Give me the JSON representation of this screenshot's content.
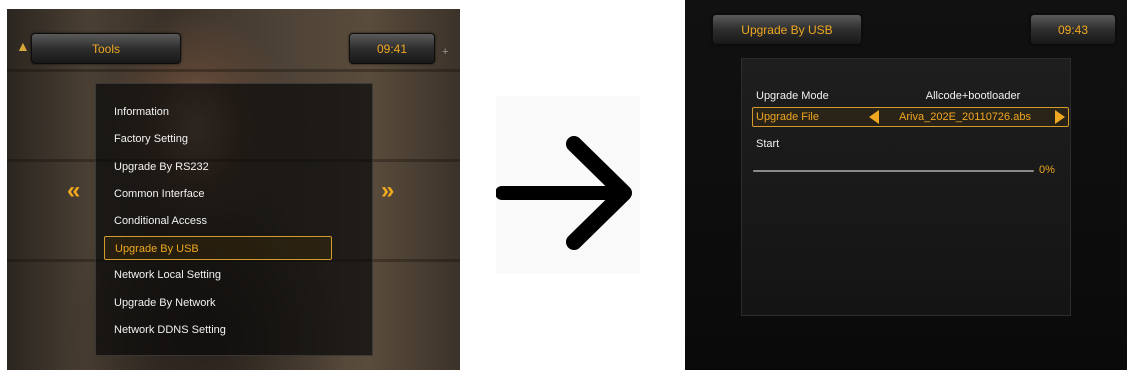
{
  "left_screen": {
    "title": "Tools",
    "clock": "09:41",
    "prev_glyph": "«",
    "next_glyph": "»",
    "logo_icon": "ariva-logo-icon",
    "menu_items": [
      "Information",
      "Factory Setting",
      "Upgrade By RS232",
      "Common Interface",
      "Conditional Access",
      "Upgrade By USB",
      "Network Local Setting",
      "Upgrade By Network",
      "Network DDNS Setting"
    ],
    "selected_index": 5
  },
  "transition_icon": "arrow-right-icon",
  "right_screen": {
    "title": "Upgrade By USB",
    "clock": "09:43",
    "upgrade_mode_label": "Upgrade Mode",
    "upgrade_mode_value": "Allcode+bootloader",
    "upgrade_file_label": "Upgrade File",
    "upgrade_file_value": "Ariva_202E_20110726.abs",
    "start_label": "Start",
    "progress_text": "0%",
    "progress_value": 0
  },
  "colors": {
    "accent": "#f0a820",
    "selection_border": "#d49a2a",
    "text": "#f0f0f0"
  }
}
